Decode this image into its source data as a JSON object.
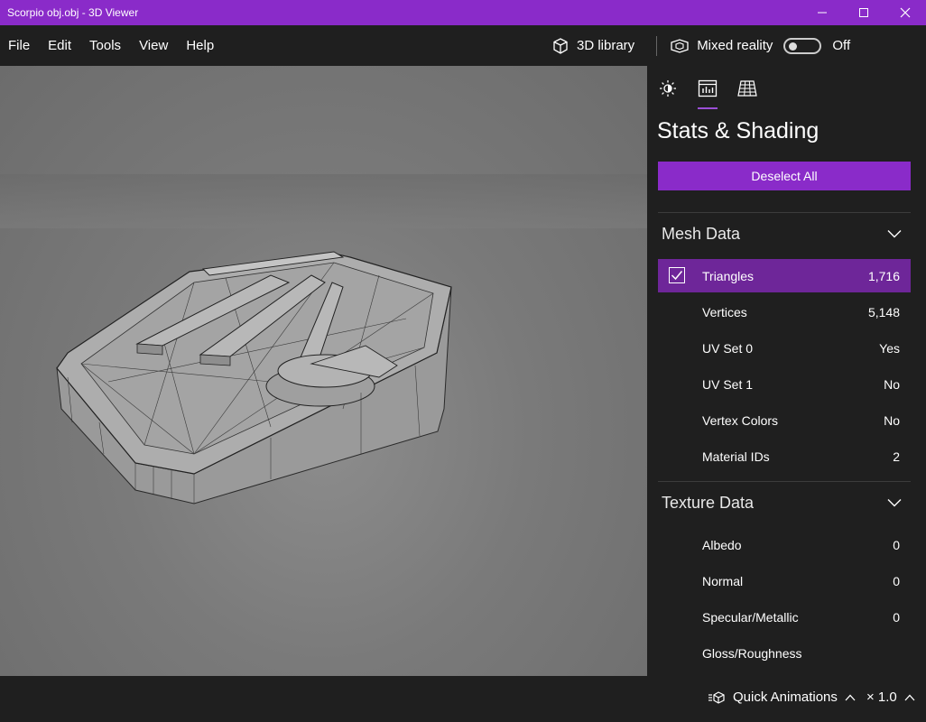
{
  "window": {
    "title": "Scorpio obj.obj - 3D Viewer",
    "controls": {
      "minimize": "─",
      "maximize": "☐",
      "close": "✕"
    }
  },
  "menu": [
    "File",
    "Edit",
    "Tools",
    "View",
    "Help"
  ],
  "toolbar": {
    "library_label": "3D library",
    "library_icon": "cube-icon",
    "mixed_reality_label": "Mixed reality",
    "mixed_reality_icon": "mixed-reality-icon",
    "mixed_reality_state": "Off"
  },
  "panel": {
    "tabs": [
      {
        "icon": "lighting-icon",
        "active": false
      },
      {
        "icon": "stats-icon",
        "active": true
      },
      {
        "icon": "grid-icon",
        "active": false
      }
    ],
    "title": "Stats & Shading",
    "deselect_label": "Deselect All",
    "mesh_section": {
      "label": "Mesh Data",
      "rows": [
        {
          "label": "Triangles",
          "value": "1,716",
          "checked": true
        },
        {
          "label": "Vertices",
          "value": "5,148"
        },
        {
          "label": "UV Set 0",
          "value": "Yes"
        },
        {
          "label": "UV Set 1",
          "value": "No"
        },
        {
          "label": "Vertex Colors",
          "value": "No"
        },
        {
          "label": "Material IDs",
          "value": "2"
        }
      ]
    },
    "texture_section": {
      "label": "Texture Data",
      "rows": [
        {
          "label": "Albedo",
          "value": "0"
        },
        {
          "label": "Normal",
          "value": "0"
        },
        {
          "label": "Specular/Metallic",
          "value": "0"
        },
        {
          "label": "Gloss/Roughness",
          "value": ""
        }
      ]
    }
  },
  "bottom": {
    "quick_animations_label": "Quick Animations",
    "speed_label": "× 1.0"
  },
  "colors": {
    "accent": "#8a2bc9",
    "selected_row": "#6e2699",
    "background": "#1f1f1f"
  }
}
